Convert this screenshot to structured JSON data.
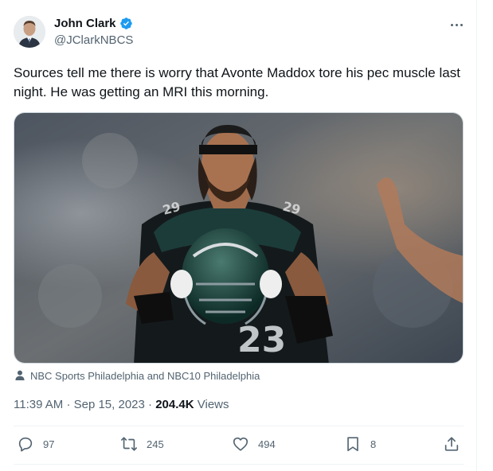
{
  "author": {
    "name": "John Clark",
    "handle": "@JClarkNBCS",
    "avatar_icon": "profile-photo",
    "verified_color": "#1d9bf0"
  },
  "tweet": {
    "text": "Sources tell me there is worry that Avonte Maddox tore his pec muscle last night. He was getting an MRI this morning.",
    "media_credit": "NBC Sports Philadelphia and NBC10 Philadelphia",
    "time": "11:39 AM",
    "date": "Sep 15, 2023",
    "views_count": "204.4K",
    "views_label": "Views"
  },
  "actions": {
    "replies": "97",
    "reposts": "245",
    "likes": "494",
    "bookmarks": "8"
  },
  "colors": {
    "text_primary": "#0f1419",
    "text_secondary": "#536471",
    "border": "#eff3f4"
  }
}
